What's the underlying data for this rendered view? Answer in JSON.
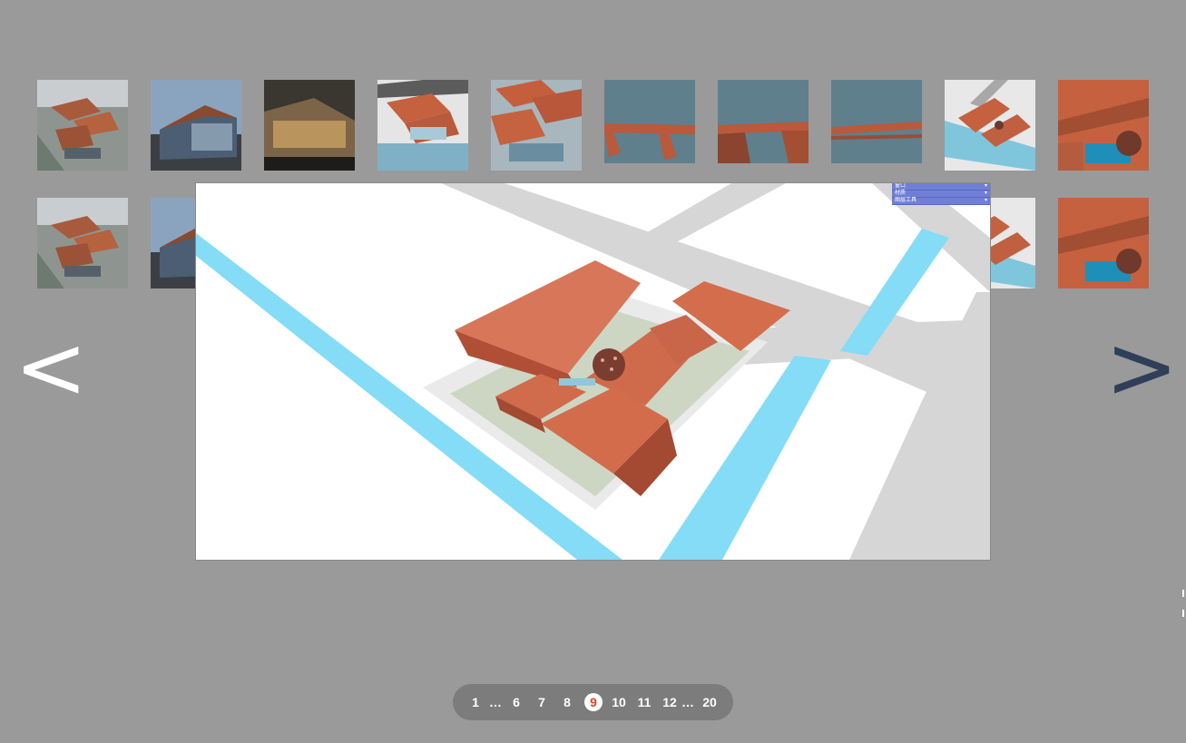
{
  "gallery": {
    "row1": [
      {
        "name": "thumb-aerial-site",
        "kind": "aerial"
      },
      {
        "name": "thumb-facade-dusk",
        "kind": "facade"
      },
      {
        "name": "thumb-night-render",
        "kind": "night"
      },
      {
        "name": "thumb-roof-frame",
        "kind": "frame"
      },
      {
        "name": "thumb-roof-cluster",
        "kind": "cluster"
      },
      {
        "name": "thumb-frame-closeup",
        "kind": "closeup"
      },
      {
        "name": "thumb-frame-closeup-2",
        "kind": "closeup2"
      },
      {
        "name": "thumb-beam-detail",
        "kind": "beam"
      },
      {
        "name": "thumb-model-overview",
        "kind": "model"
      },
      {
        "name": "thumb-courtyard-detail",
        "kind": "courtyard"
      }
    ],
    "row2_visible": [
      {
        "name": "thumb-aerial-site",
        "kind": "aerial"
      },
      {
        "name": "thumb-facade-dusk",
        "kind": "facade"
      },
      {
        "name": "thumb-model-overview",
        "kind": "model"
      },
      {
        "name": "thumb-courtyard-detail",
        "kind": "courtyard"
      }
    ]
  },
  "viewer": {
    "current_image": "model-overview",
    "mini_panel_rows": [
      "窗口",
      "材质",
      "图层工具"
    ]
  },
  "navigation": {
    "prev_label": "<",
    "next_label": ">"
  },
  "pagination": {
    "first": "1",
    "ellipsis": "…",
    "pages": [
      "6",
      "7",
      "8",
      "9",
      "10",
      "11",
      "12"
    ],
    "current": "9",
    "last": "20"
  },
  "colors": {
    "background": "#9a9a9a",
    "roof": "#d36a48",
    "water": "#84dcf7",
    "road": "#d6d6d6",
    "pager_current_text": "#d2491d",
    "next_arrow": "#2f3f58"
  }
}
